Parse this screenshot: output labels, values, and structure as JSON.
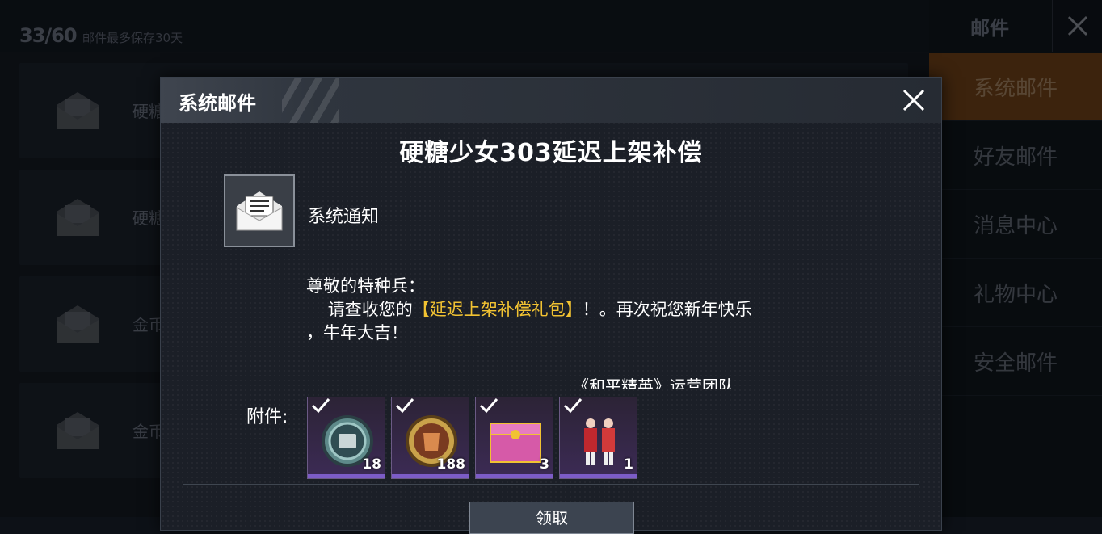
{
  "background": {
    "count": "33/60",
    "limit_note": "邮件最多保存30天",
    "mail_subjects": [
      "硬糖",
      "硬糖",
      "金币",
      "金币"
    ],
    "panel_title": "邮件",
    "tabs": [
      {
        "label": "系统邮件",
        "active": true
      },
      {
        "label": "好友邮件",
        "active": false
      },
      {
        "label": "消息中心",
        "active": false
      },
      {
        "label": "礼物中心",
        "active": false
      },
      {
        "label": "安全邮件",
        "active": false
      }
    ]
  },
  "modal": {
    "title": "系统邮件",
    "heading": "硬糖少女303延迟上架补偿",
    "sender": "系统通知",
    "greeting": "尊敬的特种兵：",
    "body_prefix": "    请查收您的",
    "body_highlight": "【延迟上架补偿礼包】",
    "body_suffix": "！。再次祝您新年快乐",
    "body_line3": "，牛年大吉！",
    "signature": "《和平精英》运营团队",
    "attachments_label": "附件:",
    "attachments": [
      {
        "icon": "coin-badge-icon",
        "qty": "18"
      },
      {
        "icon": "gold-badge-icon",
        "qty": "188"
      },
      {
        "icon": "pink-chest-icon",
        "qty": "3"
      },
      {
        "icon": "character-outfit-icon",
        "qty": "1"
      }
    ],
    "claim_label": "领取"
  },
  "colors": {
    "highlight": "#f1c232",
    "active_tab": "#6e4118",
    "item_rarity": "#7c5cc7"
  }
}
